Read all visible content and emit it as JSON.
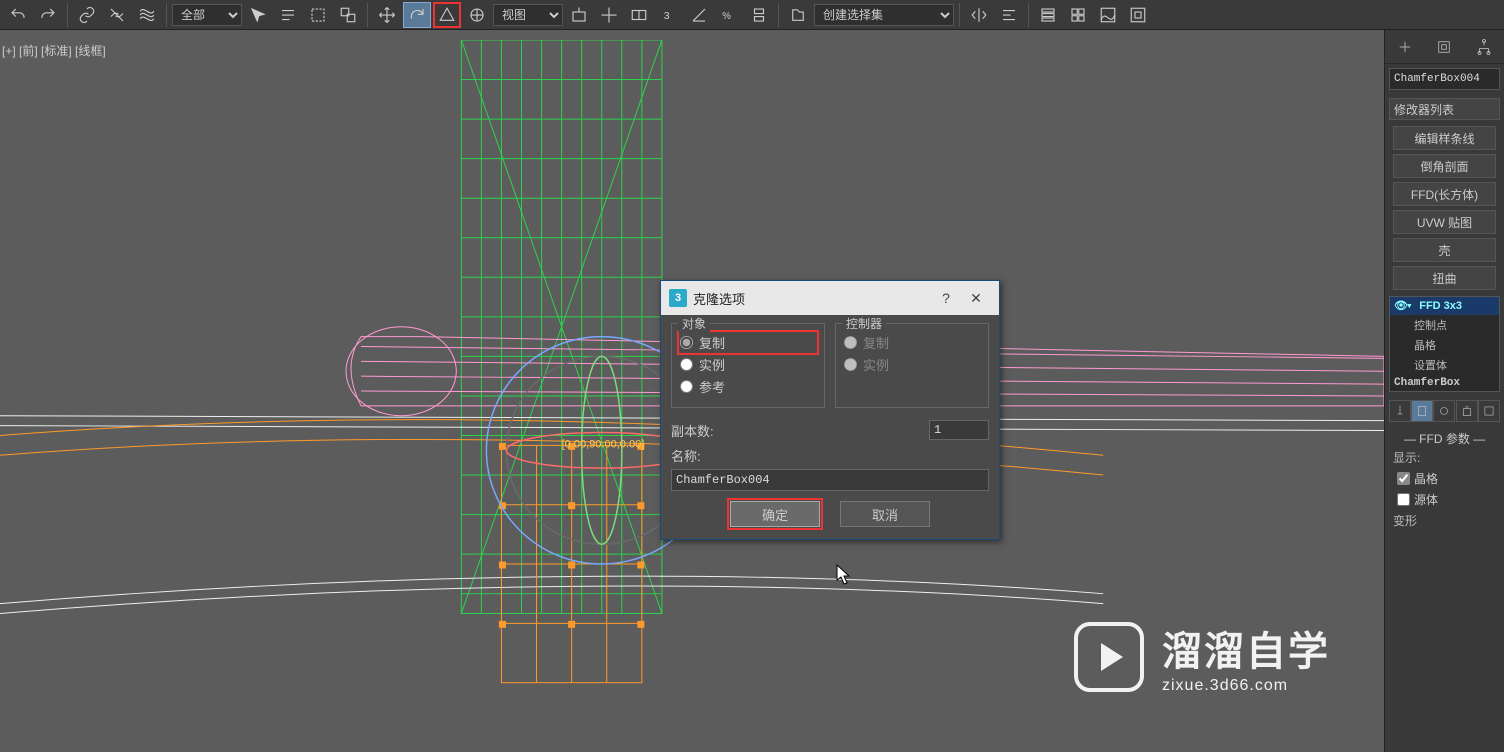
{
  "toolbar": {
    "filter": "全部",
    "view_dd": "视图",
    "create_set": "创建选择集"
  },
  "viewport": {
    "label": "[+] [前] [标准] [线框]",
    "readout": "[0.00,90.00,0.00]"
  },
  "panel": {
    "objname": "ChamferBox004",
    "modlist_label": "修改器列表",
    "buttons": {
      "edit_spline": "编辑样条线",
      "bevel_profile": "倒角剖面",
      "ffd_box": "FFD(长方体)",
      "uvw_map": "UVW 贴图",
      "shell": "壳",
      "twist": "扭曲"
    },
    "stack": {
      "active": "FFD 3x3",
      "sub1": "控制点",
      "sub2": "晶格",
      "sub3": "设置体",
      "base": "ChamferBox"
    },
    "rollout_title": "FFD 参数",
    "display_label": "显示:",
    "chk_lattice": "晶格",
    "chk_source": "源体",
    "deform_label": "变形"
  },
  "dialog": {
    "title": "克隆选项",
    "obj_legend": "对象",
    "ctrl_legend": "控制器",
    "r_copy": "复制",
    "r_instance": "实例",
    "r_reference": "参考",
    "copies_label": "副本数:",
    "copies_value": "1",
    "name_label": "名称:",
    "name_value": "ChamferBox004",
    "ok": "确定",
    "cancel": "取消",
    "help": "?",
    "close": "✕",
    "icon3": "3"
  },
  "watermark": {
    "brand": "溜溜自学",
    "url": "zixue.3d66.com"
  }
}
